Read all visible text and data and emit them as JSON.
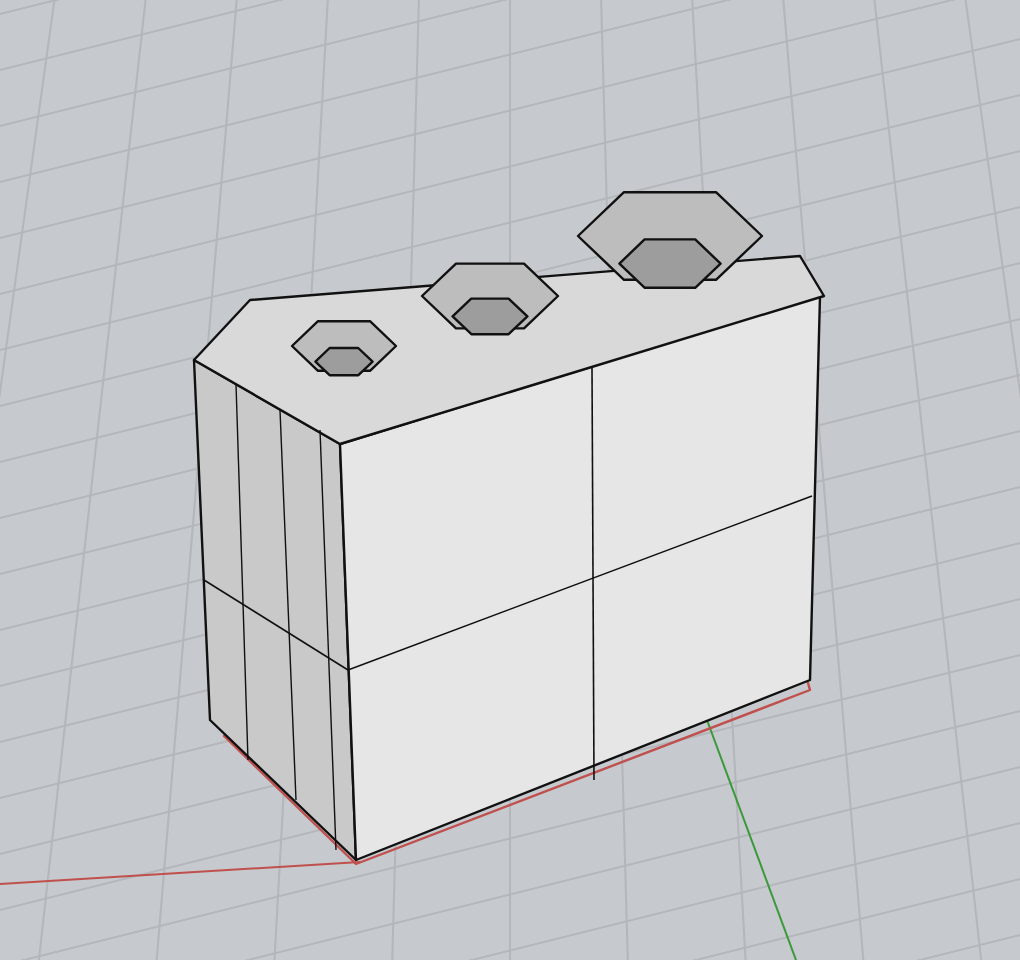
{
  "viewport": {
    "grid_visible": true,
    "axes_visible": true,
    "model_visible": true
  }
}
